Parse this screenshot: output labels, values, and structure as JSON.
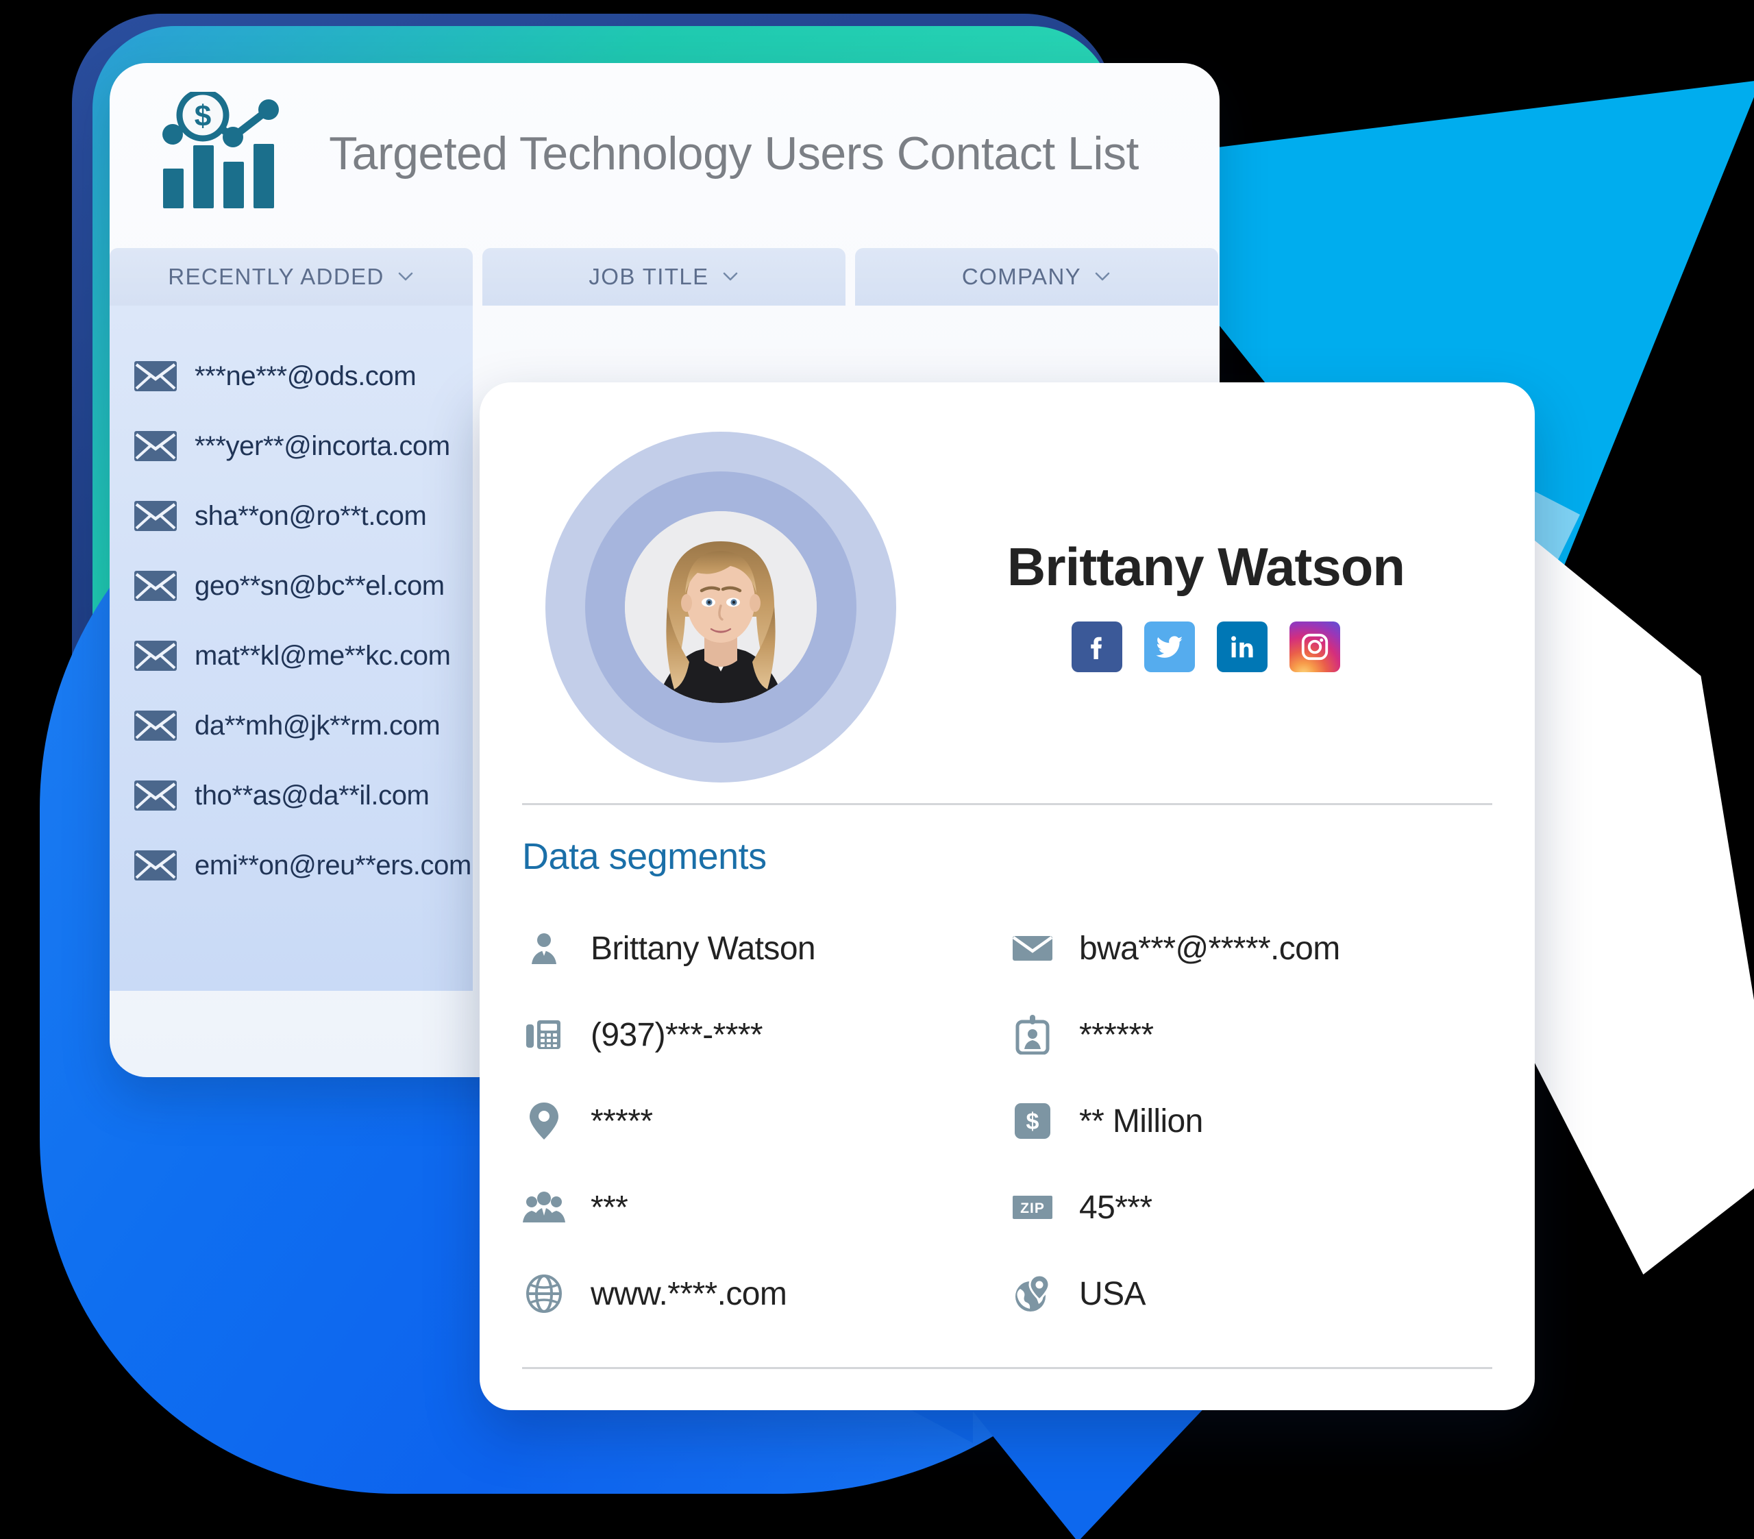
{
  "colors": {
    "accent_blue": "#1a6fa8",
    "brand_teal": "#1b6f8c",
    "panel_blue": "#cfdef7",
    "cyan_shape": "#00adee",
    "blue_shape": "#0d63ee",
    "facebook": "#3b5998",
    "twitter": "#55acee",
    "linkedin": "#0077b5",
    "avatar_ring_outer": "#c3cee9",
    "avatar_ring_inner": "#a6b5dd",
    "title_gray": "#7b7f85"
  },
  "list_card": {
    "logo_icon": "bar-chart-dollar-logo-icon",
    "title": "Targeted Technology Users Contact List",
    "columns": [
      {
        "label": "RECENTLY ADDED",
        "icon": "chevron-down-icon"
      },
      {
        "label": "JOB TITLE",
        "icon": "chevron-down-icon"
      },
      {
        "label": "COMPANY",
        "icon": "chevron-down-icon"
      }
    ],
    "emails": [
      {
        "icon": "envelope-icon",
        "address": "***ne***@ods.com"
      },
      {
        "icon": "envelope-icon",
        "address": "***yer**@incorta.com"
      },
      {
        "icon": "envelope-icon",
        "address": "sha**on@ro**t.com"
      },
      {
        "icon": "envelope-icon",
        "address": "geo**sn@bc**el.com"
      },
      {
        "icon": "envelope-icon",
        "address": "mat**kl@me**kc.com"
      },
      {
        "icon": "envelope-icon",
        "address": "da**mh@jk**rm.com"
      },
      {
        "icon": "envelope-icon",
        "address": "tho**as@da**il.com"
      },
      {
        "icon": "envelope-icon",
        "address": "emi**on@reu**ers.com"
      }
    ]
  },
  "detail_card": {
    "avatar_alt": "portrait-photo",
    "contact_name": "Brittany Watson",
    "social_links": [
      {
        "name": "facebook",
        "icon": "facebook-icon"
      },
      {
        "name": "twitter",
        "icon": "twitter-icon"
      },
      {
        "name": "linkedin",
        "icon": "linkedin-icon"
      },
      {
        "name": "instagram",
        "icon": "instagram-icon"
      }
    ],
    "segments_heading": "Data segments",
    "segments": [
      {
        "icon": "person-icon",
        "value": "Brittany Watson",
        "column": "left"
      },
      {
        "icon": "envelope-icon",
        "value": "bwa***@*****.com",
        "column": "right"
      },
      {
        "icon": "telephone-icon",
        "value": "(937)***-****",
        "column": "left"
      },
      {
        "icon": "id-badge-icon",
        "value": "******",
        "column": "right"
      },
      {
        "icon": "map-pin-icon",
        "value": "*****",
        "column": "left"
      },
      {
        "icon": "dollar-square-icon",
        "value": "** Million",
        "column": "right"
      },
      {
        "icon": "people-group-icon",
        "value": "***",
        "column": "left"
      },
      {
        "icon": "zip-badge-icon",
        "value": "45***",
        "column": "right"
      },
      {
        "icon": "globe-icon",
        "value": "www.****.com",
        "column": "left"
      },
      {
        "icon": "globe-pin-icon",
        "value": "USA",
        "column": "right"
      }
    ]
  }
}
